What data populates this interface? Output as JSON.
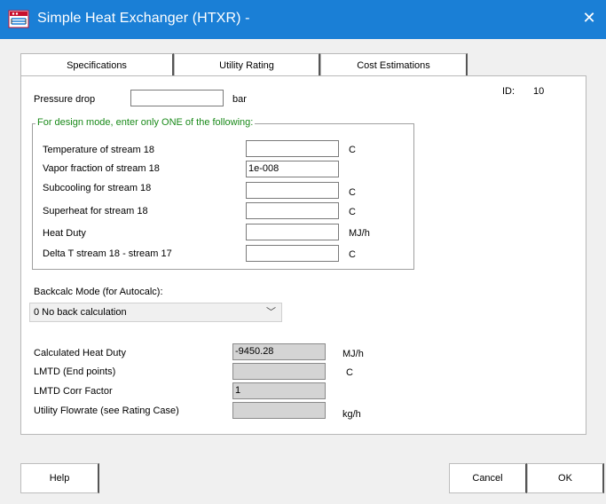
{
  "window": {
    "title": "Simple Heat Exchanger (HTXR) -",
    "close_glyph": "✕",
    "icon": "heat-exchanger-app-icon"
  },
  "tabs": [
    {
      "label": "Specifications",
      "active": true
    },
    {
      "label": "Utility Rating",
      "active": false
    },
    {
      "label": "Cost Estimations",
      "active": false
    }
  ],
  "id_label": "ID:",
  "id_value": "10",
  "pressure_drop": {
    "label": "Pressure drop",
    "value": "",
    "unit": "bar"
  },
  "design_group": {
    "title": "For design mode, enter only ONE of the following:",
    "rows": [
      {
        "label": "Temperature of stream 18",
        "value": "",
        "unit": "C"
      },
      {
        "label": "Vapor fraction of stream 18",
        "value": "1e-008",
        "unit": ""
      },
      {
        "label": "Subcooling for stream 18",
        "value": "",
        "unit": "C"
      },
      {
        "label": "Superheat for stream 18",
        "value": "",
        "unit": "C"
      },
      {
        "label": "Heat Duty",
        "value": "",
        "unit": "MJ/h"
      },
      {
        "label": "Delta T stream 18 - stream 17",
        "value": "",
        "unit": "C"
      }
    ]
  },
  "backcalc": {
    "label": "Backcalc Mode (for Autocalc):",
    "selected": "0 No back calculation",
    "arrow": "﹀"
  },
  "results": [
    {
      "label": "Calculated Heat Duty",
      "value": "-9450.28",
      "unit": "MJ/h"
    },
    {
      "label": "LMTD (End points)",
      "value": "",
      "unit": "C"
    },
    {
      "label": "LMTD Corr Factor",
      "value": "1",
      "unit": ""
    },
    {
      "label": "Utility Flowrate (see Rating Case)",
      "value": "",
      "unit": "kg/h"
    }
  ],
  "buttons": {
    "help": "Help",
    "cancel": "Cancel",
    "ok": "OK"
  }
}
